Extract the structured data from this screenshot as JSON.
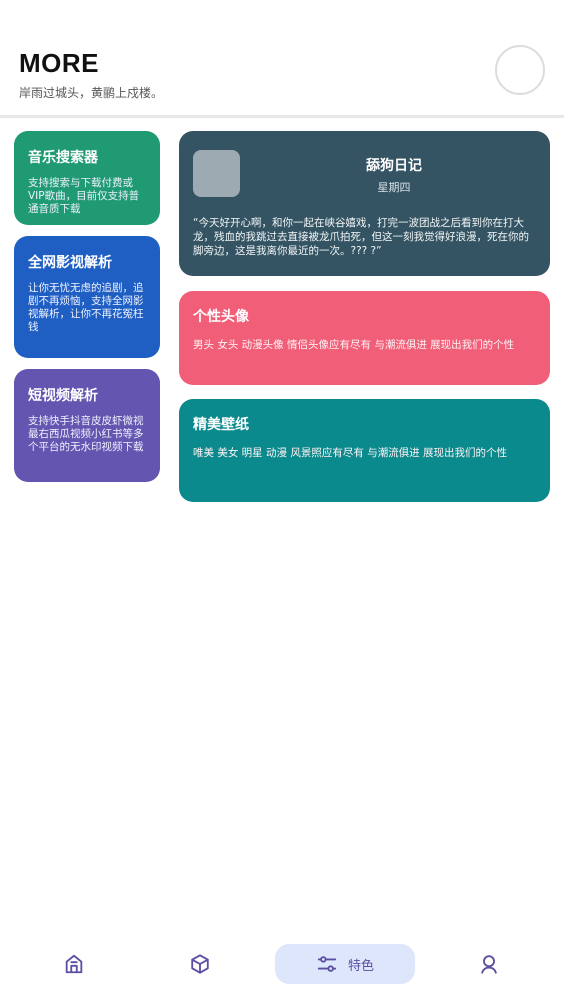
{
  "header": {
    "title": "MORE",
    "subtitle": "岸雨过城头，黄鹂上戍楼。"
  },
  "left_cards": [
    {
      "title": "音乐搜索器",
      "description": "支持搜索与下载付费或VIP歌曲，目前仅支持普通音质下载",
      "color": "#1f9a72"
    },
    {
      "title": "全网影视解析",
      "description": "让你无忧无虑的追剧，追剧不再烦恼，支持全网影视解析，让你不再花冤枉钱",
      "color": "#1f5fc4"
    },
    {
      "title": "短视频解析",
      "description": "支持快手抖音皮皮虾微视最右西瓜视频小红书等多个平台的无水印视频下载",
      "color": "#6455b0"
    }
  ],
  "diary_card": {
    "title": "舔狗日记",
    "day": "星期四",
    "text": "“今天好开心啊，和你一起在峡谷嬉戏，打完一波团战之后看到你在打大龙，残血的我跳过去直接被龙爪拍死，但这一刻我觉得好浪漫，死在你的脚旁边，这是我离你最近的一次。??? ?”",
    "color": "#355463"
  },
  "right_cards": [
    {
      "title": "个性头像",
      "description": "男头 女头 动漫头像 情侣头像应有尽有 与潮流俱进 展现出我们的个性",
      "color": "#f15e78"
    },
    {
      "title": "精美壁纸",
      "description": "唯美 美女 明星 动漫 风景照应有尽有 与潮流俱进 展现出我们的个性",
      "color": "#0b8a8d"
    }
  ],
  "bottom_nav": {
    "items": [
      {
        "icon": "home-icon",
        "label": ""
      },
      {
        "icon": "cube-icon",
        "label": ""
      },
      {
        "icon": "sliders-icon",
        "label": "特色",
        "active": true
      },
      {
        "icon": "user-icon",
        "label": ""
      }
    ],
    "accent_color": "#5b4ea3",
    "active_bg": "#dee6fb"
  }
}
